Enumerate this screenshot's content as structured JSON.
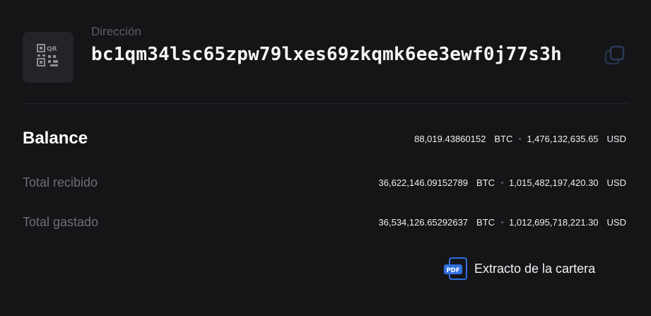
{
  "address": {
    "label": "Dirección",
    "value": "bc1qm34lsc65zpw79lxes69zkqmk6ee3ewf0j77s3h",
    "qr_icon": "qr-code-icon",
    "copy_icon": "copy-icon"
  },
  "summary": {
    "balance": {
      "label": "Balance",
      "btc": "88,019.43860152",
      "btc_unit": "BTC",
      "usd": "1,476,132,635.65",
      "usd_unit": "USD"
    },
    "received": {
      "label": "Total recibido",
      "btc": "36,622,146.09152789",
      "btc_unit": "BTC",
      "usd": "1,015,482,197,420.30",
      "usd_unit": "USD"
    },
    "spent": {
      "label": "Total gastado",
      "btc": "36,534,126.65292637",
      "btc_unit": "BTC",
      "usd": "1,012,695,718,221.30",
      "usd_unit": "USD"
    }
  },
  "statement": {
    "icon": "pdf-icon",
    "icon_text": "PDF",
    "label": "Extracto de la cartera"
  },
  "colors": {
    "background": "#151518",
    "qr_box": "#232328",
    "accent_blue": "#2f6fe0",
    "muted_text": "#6e6e78"
  }
}
